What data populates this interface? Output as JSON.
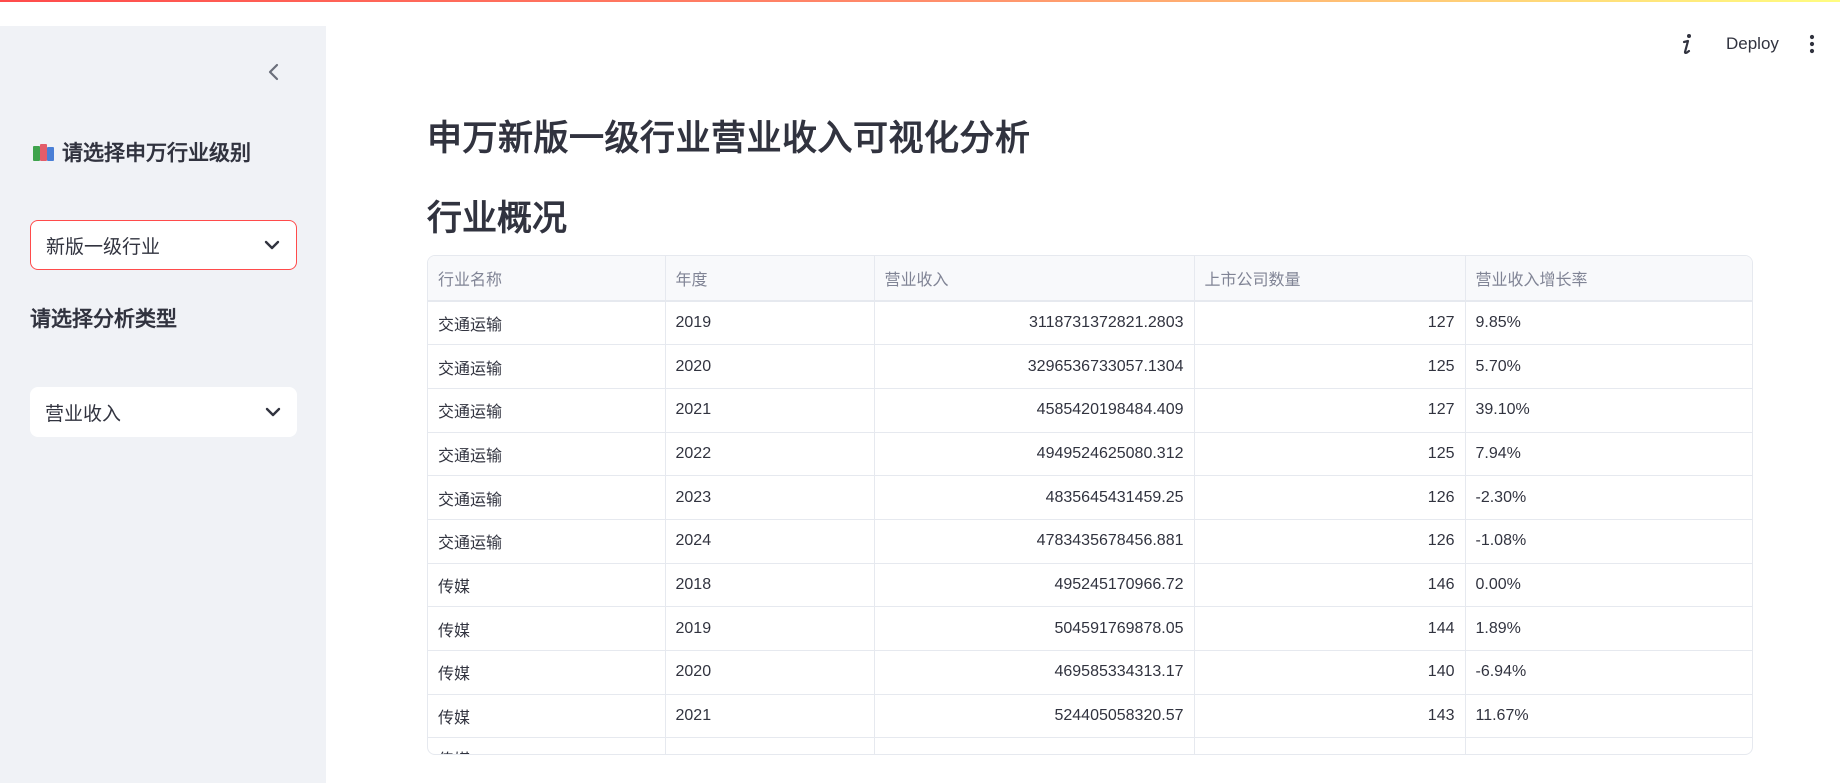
{
  "sidebar": {
    "heading": "请选择申万行业级别",
    "level_select": {
      "value": "新版一级行业"
    },
    "analysis_heading": "请选择分析类型",
    "analysis_select": {
      "value": "营业收入"
    }
  },
  "toolbar": {
    "deploy_label": "Deploy"
  },
  "main": {
    "title": "申万新版一级行业营业收入可视化分析",
    "section_title": "行业概况"
  },
  "table": {
    "columns": [
      "行业名称",
      "年度",
      "营业收入",
      "上市公司数量",
      "营业收入增长率"
    ],
    "rows": [
      [
        "交通运输",
        "2019",
        "3118731372821.2803",
        "127",
        "9.85%"
      ],
      [
        "交通运输",
        "2020",
        "3296536733057.1304",
        "125",
        "5.70%"
      ],
      [
        "交通运输",
        "2021",
        "4585420198484.409",
        "127",
        "39.10%"
      ],
      [
        "交通运输",
        "2022",
        "4949524625080.312",
        "125",
        "7.94%"
      ],
      [
        "交通运输",
        "2023",
        "4835645431459.25",
        "126",
        "-2.30%"
      ],
      [
        "交通运输",
        "2024",
        "4783435678456.881",
        "126",
        "-1.08%"
      ],
      [
        "传媒",
        "2018",
        "495245170966.72",
        "146",
        "0.00%"
      ],
      [
        "传媒",
        "2019",
        "504591769878.05",
        "144",
        "1.89%"
      ],
      [
        "传媒",
        "2020",
        "469585334313.17",
        "140",
        "-6.94%"
      ],
      [
        "传媒",
        "2021",
        "524405058320.57",
        "143",
        "11.67%"
      ]
    ],
    "partial_row_label": "传媒"
  },
  "colors": {
    "accent": "#ff4b4b",
    "sidebar_bg": "#f0f2f6",
    "text": "#31333f",
    "header_text": "#808495"
  },
  "icons": {
    "collapse": "chevron-left-icon",
    "heading": "books-icon",
    "select_arrow": "chevron-down-icon",
    "info": "info-icon",
    "menu": "kebab-menu-icon"
  }
}
